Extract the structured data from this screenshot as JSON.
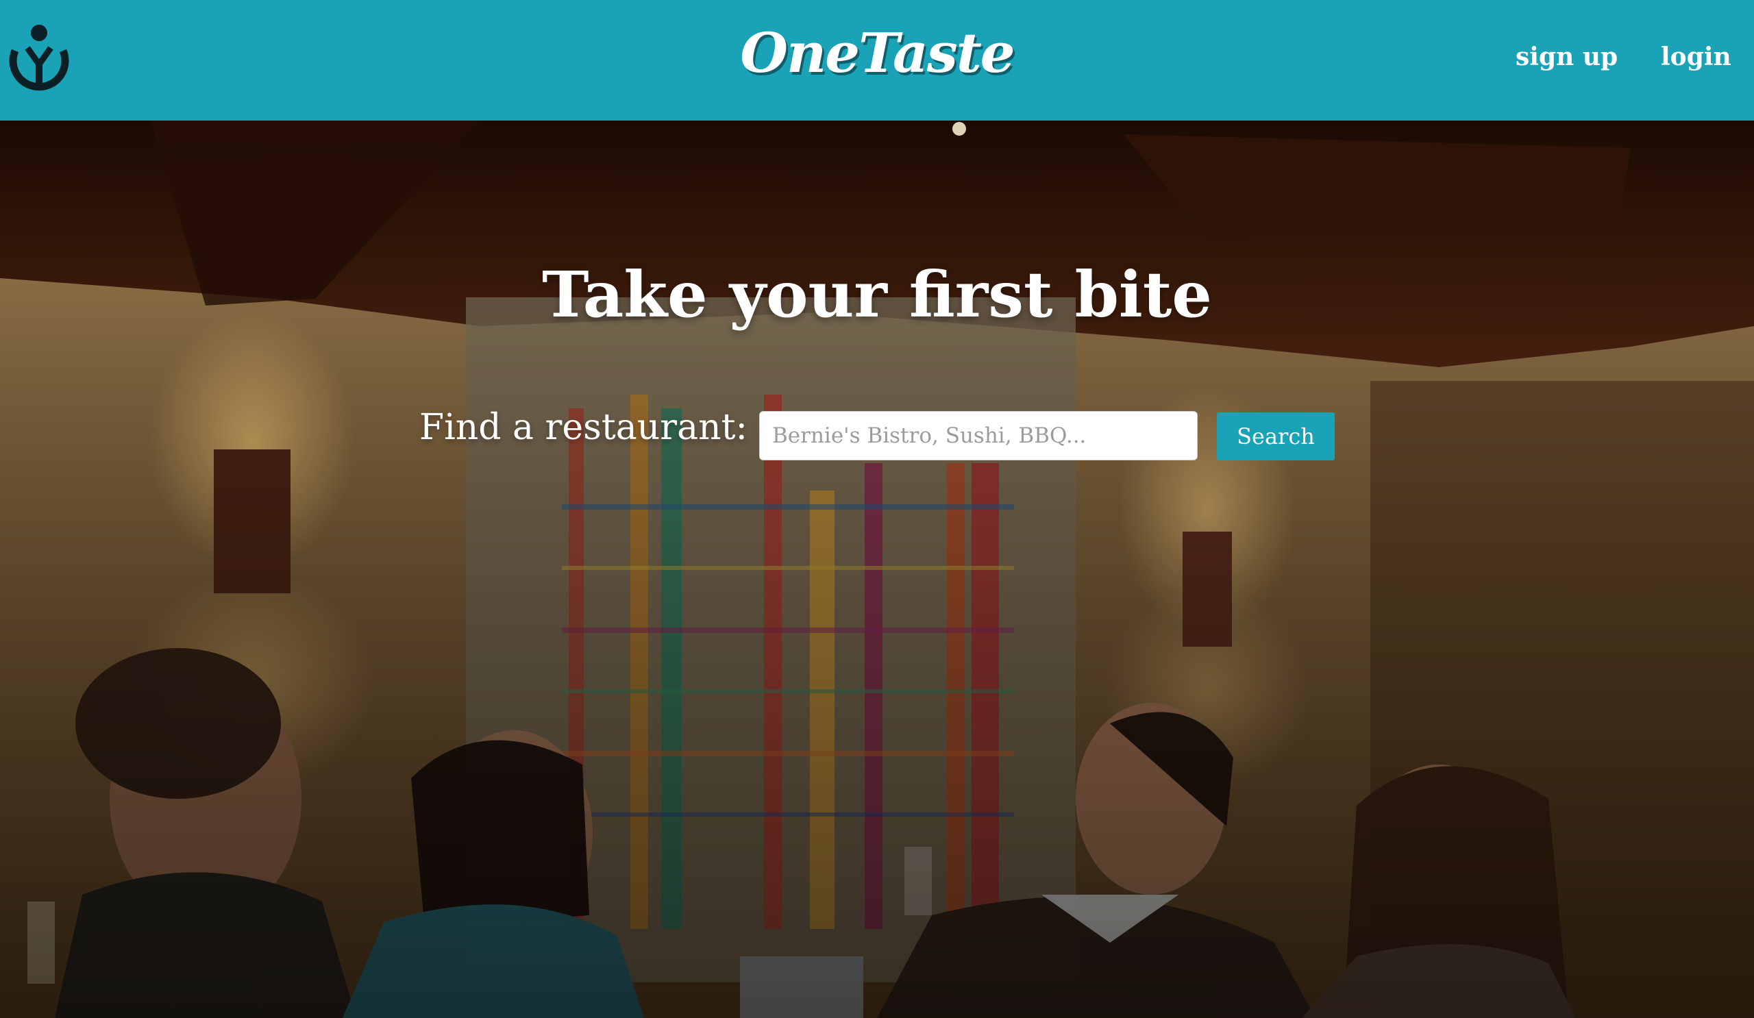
{
  "header": {
    "brand": "OneTaste",
    "logo_icon": "wikimedia-logo-icon",
    "nav": {
      "signup_label": "sign up",
      "login_label": "login"
    }
  },
  "hero": {
    "title": "Take your first bite",
    "search": {
      "label": "Find a restaurant:",
      "placeholder": "Bernie's Bistro, Sushi, BBQ...",
      "value": "",
      "button_label": "Search"
    },
    "background_image": "restaurant-diners-photo"
  },
  "colors": {
    "accent": "#1aa2b6",
    "brand_shadow": "#0e5e6b",
    "text_on_accent": "#ffffff"
  }
}
